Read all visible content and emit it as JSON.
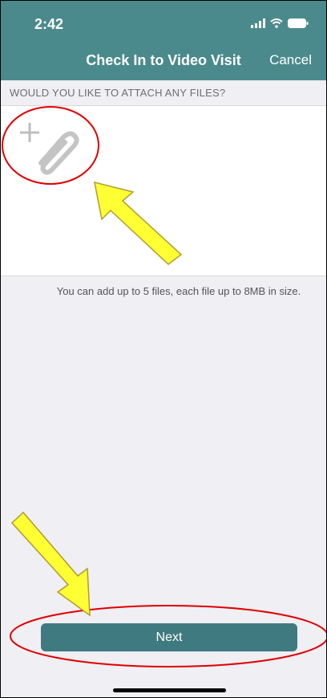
{
  "status_bar": {
    "time": "2:42",
    "icons": [
      "signal-icon",
      "wifi-icon",
      "battery-icon"
    ]
  },
  "nav": {
    "title": "Check In to Video Visit",
    "cancel_label": "Cancel"
  },
  "section": {
    "label": "WOULD YOU LIKE TO ATTACH ANY FILES?"
  },
  "attach": {
    "icon": "add-attachment-icon"
  },
  "hint": "You can add up to 5 files, each file up to 8MB in size.",
  "footer": {
    "next_label": "Next"
  },
  "colors": {
    "header": "#4a8a8c",
    "button": "#3f7a80",
    "annotation_circle": "#e00000",
    "annotation_arrow": "#ffff33"
  }
}
